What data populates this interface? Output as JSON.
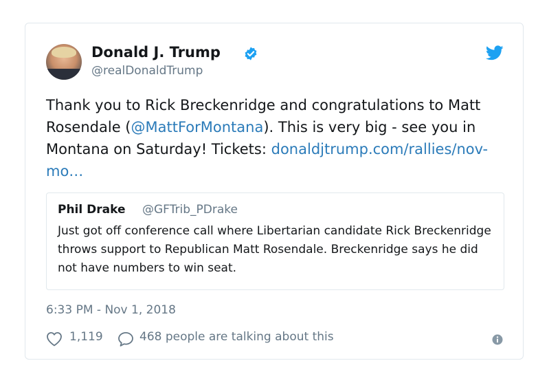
{
  "author": {
    "name": "Donald J. Trump",
    "handle": "@realDonaldTrump"
  },
  "tweet": {
    "text_1": "Thank you to Rick Breckenridge and congratulations to Matt Rosendale (",
    "mention": "@MattForMontana",
    "text_2": "). This is very big - see you in Montana on Saturday! Tickets: ",
    "link": "donaldjtrump.com/rallies/nov-mo…"
  },
  "quote": {
    "name": "Phil Drake",
    "handle": "@GFTrib_PDrake",
    "text": "Just got off conference call where Libertarian candidate Rick Breckenridge throws support to Republican Matt Rosendale. Breckenridge says he did not have numbers to win seat."
  },
  "timestamp": "6:33 PM - Nov 1, 2018",
  "actions": {
    "likes": "1,119",
    "talking": "468 people are talking about this"
  },
  "colors": {
    "link": "#2b7bb9",
    "twitter_blue": "#1da1f2",
    "secondary_text": "#657786",
    "border": "#e1e8ed"
  },
  "icons": [
    "verified-badge-icon",
    "twitter-bird-icon",
    "heart-icon",
    "comment-bubble-icon",
    "info-icon"
  ]
}
